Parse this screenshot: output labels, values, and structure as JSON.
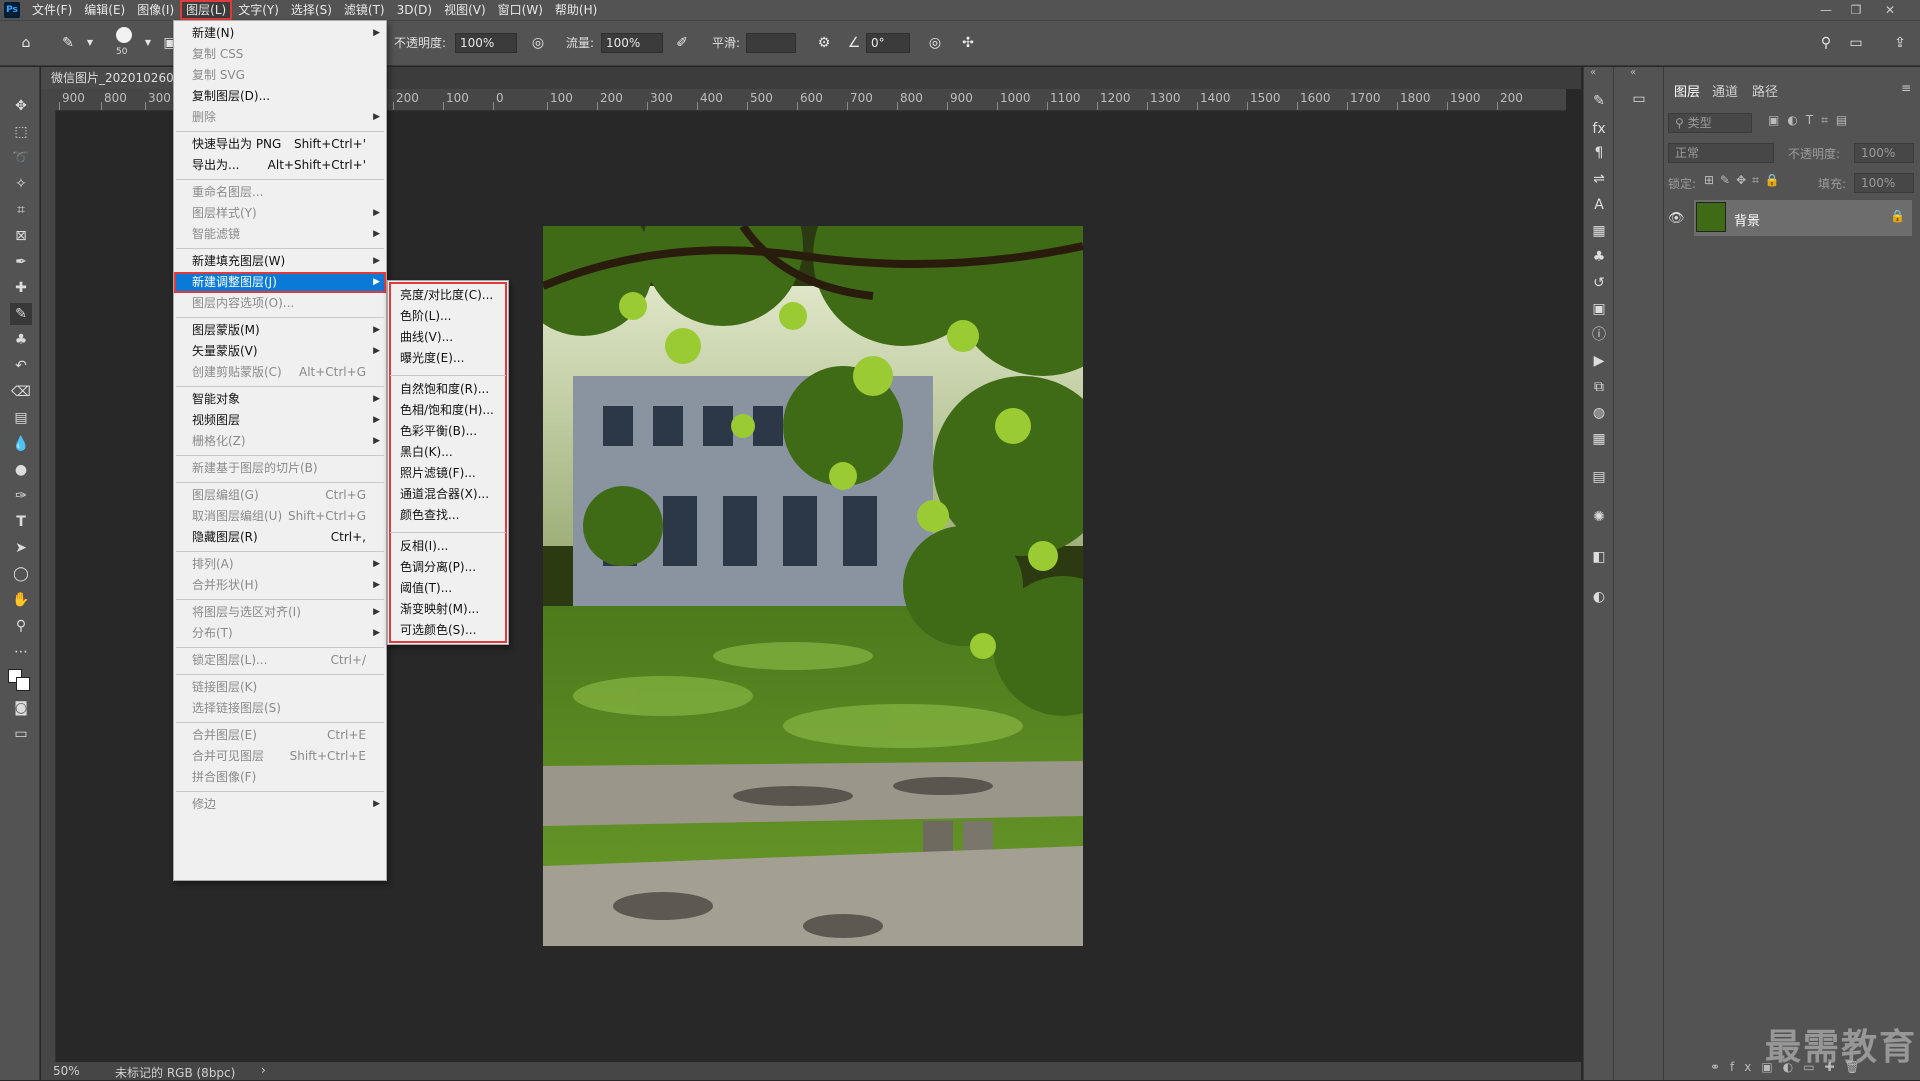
{
  "menubar": {
    "items": [
      "文件(F)",
      "编辑(E)",
      "图像(I)",
      "图层(L)",
      "文字(Y)",
      "选择(S)",
      "滤镜(T)",
      "3D(D)",
      "视图(V)",
      "窗口(W)",
      "帮助(H)"
    ]
  },
  "options": {
    "brush_size": "50",
    "opacity_label": "不透明度:",
    "opacity_value": "100%",
    "flow_label": "流量:",
    "flow_value": "100%",
    "smooth_label": "平滑:",
    "angle_value": "0°"
  },
  "document": {
    "tab_title": "微信图片_202010260"
  },
  "ruler": {
    "ticks": [
      "900",
      "800",
      "300",
      "200",
      "100",
      "0",
      "100",
      "200",
      "300",
      "400",
      "500",
      "600",
      "700",
      "800",
      "900",
      "1000",
      "1100",
      "1200",
      "1300",
      "1400",
      "1500",
      "1600",
      "1700",
      "1800",
      "1900",
      "200"
    ]
  },
  "layer_menu": {
    "items": [
      {
        "label": "新建(N)",
        "shortcut": "",
        "arrow": true,
        "disabled": false
      },
      {
        "label": "复制 CSS",
        "shortcut": "",
        "arrow": false,
        "disabled": true
      },
      {
        "label": "复制 SVG",
        "shortcut": "",
        "arrow": false,
        "disabled": true
      },
      {
        "label": "复制图层(D)...",
        "shortcut": "",
        "arrow": false,
        "disabled": false
      },
      {
        "label": "删除",
        "shortcut": "",
        "arrow": true,
        "disabled": true
      },
      {
        "label": "快速导出为 PNG",
        "shortcut": "Shift+Ctrl+'",
        "arrow": false,
        "disabled": false
      },
      {
        "label": "导出为...",
        "shortcut": "Alt+Shift+Ctrl+'",
        "arrow": false,
        "disabled": false
      },
      {
        "label": "重命名图层...",
        "shortcut": "",
        "arrow": false,
        "disabled": true
      },
      {
        "label": "图层样式(Y)",
        "shortcut": "",
        "arrow": true,
        "disabled": true
      },
      {
        "label": "智能滤镜",
        "shortcut": "",
        "arrow": true,
        "disabled": true
      },
      {
        "label": "新建填充图层(W)",
        "shortcut": "",
        "arrow": true,
        "disabled": false
      },
      {
        "label": "新建调整图层(J)",
        "shortcut": "",
        "arrow": true,
        "disabled": false,
        "highlight": true
      },
      {
        "label": "图层内容选项(O)...",
        "shortcut": "",
        "arrow": false,
        "disabled": true
      },
      {
        "label": "图层蒙版(M)",
        "shortcut": "",
        "arrow": true,
        "disabled": false
      },
      {
        "label": "矢量蒙版(V)",
        "shortcut": "",
        "arrow": true,
        "disabled": false
      },
      {
        "label": "创建剪贴蒙版(C)",
        "shortcut": "Alt+Ctrl+G",
        "arrow": false,
        "disabled": true
      },
      {
        "label": "智能对象",
        "shortcut": "",
        "arrow": true,
        "disabled": false
      },
      {
        "label": "视频图层",
        "shortcut": "",
        "arrow": true,
        "disabled": false
      },
      {
        "label": "栅格化(Z)",
        "shortcut": "",
        "arrow": true,
        "disabled": true
      },
      {
        "label": "新建基于图层的切片(B)",
        "shortcut": "",
        "arrow": false,
        "disabled": true
      },
      {
        "label": "图层编组(G)",
        "shortcut": "Ctrl+G",
        "arrow": false,
        "disabled": true
      },
      {
        "label": "取消图层编组(U)",
        "shortcut": "Shift+Ctrl+G",
        "arrow": false,
        "disabled": true
      },
      {
        "label": "隐藏图层(R)",
        "shortcut": "Ctrl+,",
        "arrow": false,
        "disabled": false
      },
      {
        "label": "排列(A)",
        "shortcut": "",
        "arrow": true,
        "disabled": true
      },
      {
        "label": "合并形状(H)",
        "shortcut": "",
        "arrow": true,
        "disabled": true
      },
      {
        "label": "将图层与选区对齐(I)",
        "shortcut": "",
        "arrow": true,
        "disabled": true
      },
      {
        "label": "分布(T)",
        "shortcut": "",
        "arrow": true,
        "disabled": true
      },
      {
        "label": "锁定图层(L)...",
        "shortcut": "Ctrl+/",
        "arrow": false,
        "disabled": true
      },
      {
        "label": "链接图层(K)",
        "shortcut": "",
        "arrow": false,
        "disabled": true
      },
      {
        "label": "选择链接图层(S)",
        "shortcut": "",
        "arrow": false,
        "disabled": true
      },
      {
        "label": "合并图层(E)",
        "shortcut": "Ctrl+E",
        "arrow": false,
        "disabled": true
      },
      {
        "label": "合并可见图层",
        "shortcut": "Shift+Ctrl+E",
        "arrow": false,
        "disabled": true
      },
      {
        "label": "拼合图像(F)",
        "shortcut": "",
        "arrow": false,
        "disabled": true
      },
      {
        "label": "修边",
        "shortcut": "",
        "arrow": true,
        "disabled": true
      }
    ]
  },
  "adjust_submenu": {
    "items": [
      "亮度/对比度(C)...",
      "色阶(L)...",
      "曲线(V)...",
      "曝光度(E)...",
      "自然饱和度(R)...",
      "色相/饱和度(H)...",
      "色彩平衡(B)...",
      "黑白(K)...",
      "照片滤镜(F)...",
      "通道混合器(X)...",
      "颜色查找...",
      "反相(I)...",
      "色调分离(P)...",
      "阈值(T)...",
      "渐变映射(M)...",
      "可选颜色(S)..."
    ]
  },
  "layers_panel": {
    "tabs": [
      "图层",
      "通道",
      "路径"
    ],
    "kind_filter": "类型",
    "blend_mode": "正常",
    "opacity_label": "不透明度:",
    "opacity_value": "100%",
    "lock_label": "锁定:",
    "fill_label": "填充:",
    "fill_value": "100%",
    "layer_name": "背景"
  },
  "status": {
    "zoom": "50%",
    "profile": "未标记的 RGB (8bpc)"
  },
  "watermark": "最需教育",
  "colors": {
    "accent": "#0b7ad6",
    "highlight_outline": "#e03a3a",
    "chrome": "#535353",
    "canvas": "#282828"
  }
}
